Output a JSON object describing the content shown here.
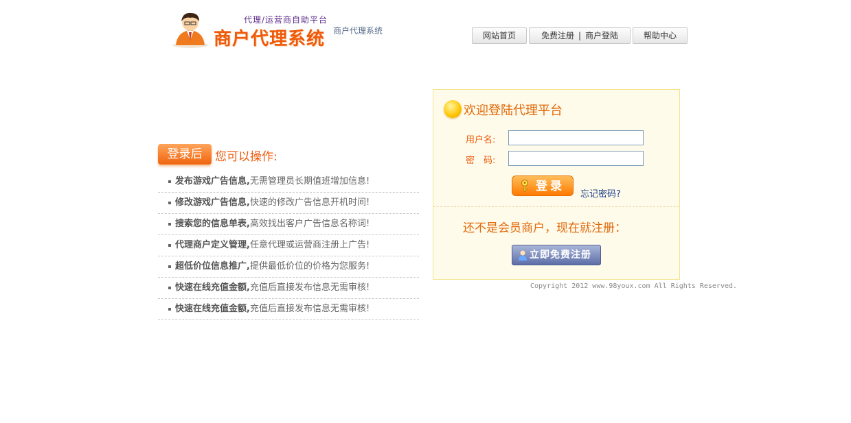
{
  "header": {
    "slogan": "代理/运营商自助平台",
    "system_title": "商户代理系统",
    "system_subtitle": "商户代理系统"
  },
  "nav": {
    "home": "网站首页",
    "register": "免费注册",
    "separator": "|",
    "merchant_login": "商户登陆",
    "help": "帮助中心"
  },
  "features_section": {
    "badge": "登录后",
    "heading": "您可以操作:",
    "items": [
      {
        "title": "发布游戏广告信息,",
        "desc": "无需管理员长期值班增加信息!"
      },
      {
        "title": "修改游戏广告信息,",
        "desc": "快速的修改广告信息开机时间!"
      },
      {
        "title": "搜索您的信息单表,",
        "desc": "高效找出客户广告信息名称词!"
      },
      {
        "title": "代理商户定义管理,",
        "desc": "任意代理或运营商注册上广告!"
      },
      {
        "title": "超低价位信息推广,",
        "desc": "提供最低价位的价格为您服务!"
      },
      {
        "title": "快速在线充值金额,",
        "desc": "充值后直接发布信息无需审核!"
      },
      {
        "title": "快速在线充值金额,",
        "desc": "充值后直接发布信息无需审核!"
      }
    ]
  },
  "login": {
    "title": "欢迎登陆代理平台",
    "username_label": "用户名:",
    "password_label": "密　码:",
    "username_value": "",
    "password_value": "",
    "login_button": "登录",
    "forgot_password": "忘记密码?",
    "register_prompt": "还不是会员商户，现在就注册：",
    "register_button": "立即免费注册"
  },
  "footer": {
    "copyright": "Copyright 2012 www.98youx.com All Rights Reserved."
  },
  "colors": {
    "accent_orange": "#ee5a0a",
    "login_bg": "#fffbea",
    "register_blue": "#5d6ea8"
  }
}
